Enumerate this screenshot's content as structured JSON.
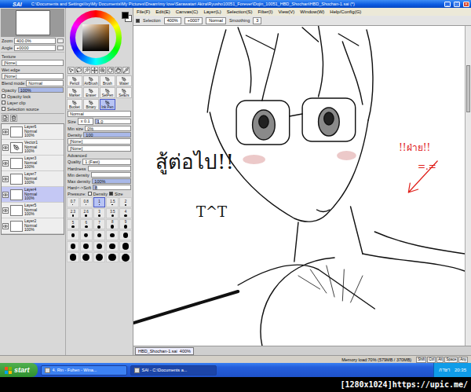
{
  "window": {
    "logo": "SAI",
    "title": "C:\\Documents and Settings\\Ixy\\My Documents\\My Pictures\\Dream\\my love\\Sarawatari Akira\\Ryusho10051_Forever\\Dojin_10051_HBD_Shochan\\HBD_Shochan-1.sai (*)",
    "controls": [
      "_",
      "□",
      "×"
    ]
  },
  "menu": [
    "File(F)",
    "Edit(E)",
    "Canvas(C)",
    "Layer(L)",
    "Selection(S)",
    "Filter(I)",
    "View(V)",
    "Window(W)",
    "Help/Config(G)"
  ],
  "toolbar": {
    "selection": {
      "label": "Selection",
      "checked": true
    },
    "zoom": "400%",
    "angle": "+0007",
    "blend": "Normal",
    "smoothing_label": "Smoothing",
    "smoothing": "3"
  },
  "navigator": {
    "zoom_label": "Zoom",
    "zoom": "400.0%",
    "angle_label": "Angle",
    "angle": "+0000"
  },
  "layer_props": {
    "texture_label": "Texture",
    "texture": "[None]",
    "wet_label": "Wet edge",
    "wet": "[None]",
    "blend_label": "Blend mode",
    "blend": "Normal",
    "opacity_label": "Opacity",
    "opacity": "100%",
    "opacity_level": 1,
    "options": [
      {
        "label": "Opacity lock",
        "checked": false
      },
      {
        "label": "Layer clip",
        "checked": false
      },
      {
        "label": "Selection source",
        "checked": false
      }
    ]
  },
  "layers": [
    {
      "name": "Layer6",
      "mode": "Normal",
      "opacity": "100%",
      "visible": true,
      "selected": false,
      "kind": "raster"
    },
    {
      "name": "Vector1",
      "mode": "Normal",
      "opacity": "100%",
      "visible": true,
      "selected": false,
      "kind": "vector"
    },
    {
      "name": "Layer3",
      "mode": "Normal",
      "opacity": "100%",
      "visible": true,
      "selected": false,
      "kind": "raster"
    },
    {
      "name": "Layer7",
      "mode": "Normal",
      "opacity": "100%",
      "visible": true,
      "selected": false,
      "kind": "raster"
    },
    {
      "name": "Layer4",
      "mode": "Normal",
      "opacity": "100%",
      "visible": true,
      "selected": true,
      "kind": "raster"
    },
    {
      "name": "Layer5",
      "mode": "Normal",
      "opacity": "100%",
      "visible": true,
      "selected": false,
      "kind": "raster"
    },
    {
      "name": "Layer2",
      "mode": "Normal",
      "opacity": "100%",
      "visible": true,
      "selected": false,
      "kind": "raster"
    }
  ],
  "tools": [
    {
      "label": "Pencil",
      "selected": false
    },
    {
      "label": "AirBrush",
      "selected": false
    },
    {
      "label": "Brush",
      "selected": false
    },
    {
      "label": "Water",
      "selected": false
    },
    {
      "label": "Marker",
      "selected": false
    },
    {
      "label": "Eraser",
      "selected": false
    },
    {
      "label": "SelPen",
      "selected": false
    },
    {
      "label": "SelErs",
      "selected": false
    },
    {
      "label": "Bucket",
      "selected": false
    },
    {
      "label": "Binary",
      "selected": false
    },
    {
      "label": "Ink Pen",
      "selected": true
    }
  ],
  "brush": {
    "mode": "Normal",
    "size_label": "Size",
    "size_mult": "x 0.1",
    "size": "1.0",
    "size_level": 0.1,
    "min_size_label": "Min size",
    "min_size": "0%",
    "min_size_level": 0,
    "density_label": "Density",
    "density": "100",
    "density_level": 1,
    "textures": [
      "[None]",
      "[None]"
    ],
    "advanced": "Advanced",
    "quality_label": "Quality",
    "quality": "1 (Fast)",
    "hardness_label": "Hardness",
    "min_density_label": "Min density",
    "max_density_label": "Max density",
    "max_density": "100%",
    "hardsoft_label": "Hard<->Soft",
    "hardsoft": "8",
    "pressure_label": "Pressure:",
    "pressure": [
      {
        "label": "Density",
        "checked": false
      },
      {
        "label": "Size",
        "checked": true
      }
    ]
  },
  "sizes": [
    {
      "label": "0.7",
      "selected": false
    },
    {
      "label": "0.8",
      "selected": false
    },
    {
      "label": "1",
      "selected": true
    },
    {
      "label": "1.5",
      "selected": false
    },
    {
      "label": "2",
      "selected": false
    },
    {
      "label": "2.3",
      "selected": false
    },
    {
      "label": "2.6",
      "selected": false
    },
    {
      "label": "3",
      "selected": false
    },
    {
      "label": "3.5",
      "selected": false
    },
    {
      "label": "4",
      "selected": false
    },
    {
      "label": "5",
      "selected": false
    },
    {
      "label": "6",
      "selected": false
    },
    {
      "label": "7",
      "selected": false
    },
    {
      "label": "8",
      "selected": false
    },
    {
      "label": "9",
      "selected": false
    },
    {
      "label": "",
      "selected": false
    },
    {
      "label": "",
      "selected": false
    },
    {
      "label": "",
      "selected": false
    },
    {
      "label": "",
      "selected": false
    },
    {
      "label": "",
      "selected": false
    },
    {
      "label": "",
      "selected": false
    },
    {
      "label": "",
      "selected": false
    },
    {
      "label": "",
      "selected": false
    },
    {
      "label": "",
      "selected": false
    },
    {
      "label": "",
      "selected": false
    },
    {
      "label": "",
      "selected": false
    },
    {
      "label": "",
      "selected": false
    },
    {
      "label": "",
      "selected": false
    },
    {
      "label": "",
      "selected": false
    },
    {
      "label": "",
      "selected": false
    }
  ],
  "canvas": {
    "texts": [
      {
        "text": "สู้ต่อไป!!",
        "color": "#111111"
      },
      {
        "text": "T^T",
        "color": "#111111"
      },
      {
        "text": "!!ฝ่าย!!",
        "color": "#e0201a"
      },
      {
        "text": "=.=",
        "color": "#e0201a"
      }
    ]
  },
  "canvas_tab": {
    "name": "HBD_Shochan-1.sai",
    "zoom": "400%"
  },
  "status": {
    "memory": "Memory load:70% (579MB / 370MB)",
    "keys": [
      "Shift",
      "Ctrl",
      "Alt",
      "Space",
      "Any"
    ]
  },
  "taskbar": {
    "start": "start",
    "tasks": [
      {
        "label": "4. Rin - Fuhen - Wina...",
        "selected": false
      },
      {
        "label": "SAI - C:\\Documents a...",
        "selected": true
      }
    ],
    "tray": "ภาษา",
    "clock": "20:35"
  },
  "watermark": "[1280x1024]https://upic.me/"
}
